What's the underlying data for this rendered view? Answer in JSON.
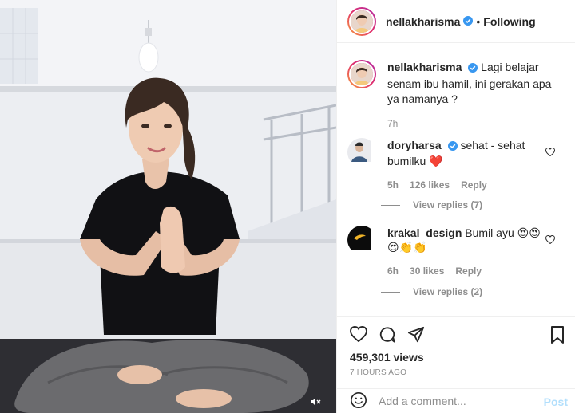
{
  "post": {
    "author": "nellakharisma",
    "follow_status": "Following",
    "dot": "•",
    "caption": "Lagi belajar senam ibu hamil, ini gerakan apa ya namanya ?",
    "caption_time": "7h",
    "views": "459,301 views",
    "time_ago": "7 HOURS AGO"
  },
  "comments": [
    {
      "username": "doryharsa",
      "text": "sehat - sehat bumilku",
      "emoji": "❤️",
      "time": "5h",
      "likes": "126 likes",
      "reply_label": "Reply",
      "view_replies": "View replies (7)"
    },
    {
      "username": "krakal_design",
      "text": "Bumil ayu",
      "emoji": "😍😍😍👏👏",
      "time": "6h",
      "likes": "30 likes",
      "reply_label": "Reply",
      "view_replies": "View replies (2)"
    }
  ],
  "add_comment": {
    "placeholder": "Add a comment...",
    "post_label": "Post"
  },
  "icons": {
    "like": "heart-icon",
    "comment": "comment-icon",
    "share": "paper-plane-icon",
    "save": "bookmark-icon",
    "emoji": "smiley-icon",
    "mute": "speaker-muted-icon",
    "verified": "verified-badge-icon"
  },
  "colors": {
    "verified_blue": "#3897f0",
    "heart_red": "#ed4956",
    "post_disabled": "#b2dffc",
    "muted_text": "#8e8e8e"
  }
}
